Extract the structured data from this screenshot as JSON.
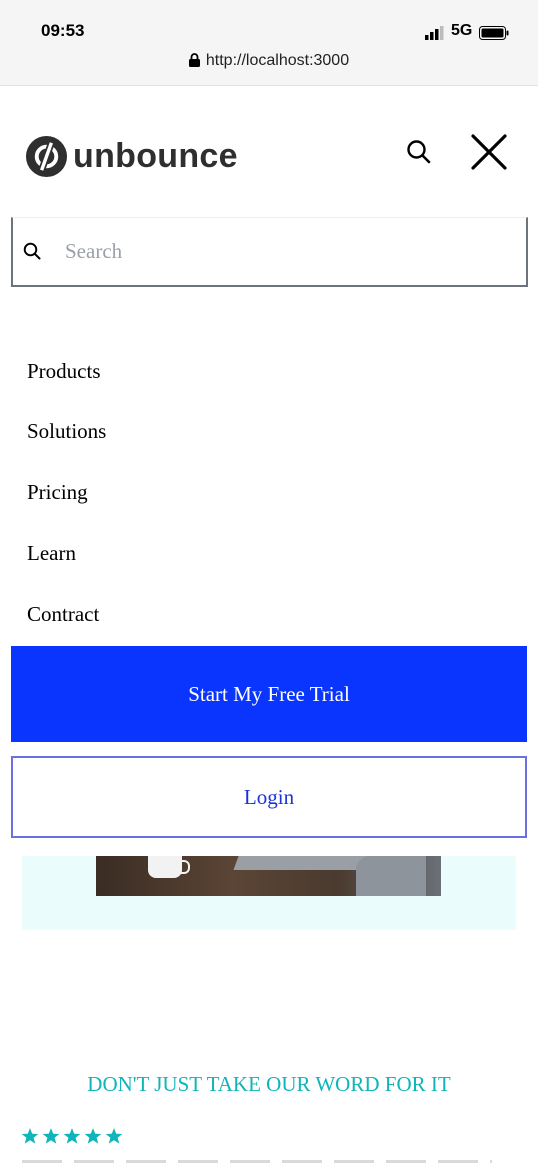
{
  "status_bar": {
    "time": "09:53",
    "network": "5G",
    "url": "http://localhost:3000"
  },
  "header": {
    "logo_text": "unbounce"
  },
  "search": {
    "placeholder": "Search",
    "value": ""
  },
  "menu": {
    "items": [
      {
        "label": "Products"
      },
      {
        "label": "Solutions"
      },
      {
        "label": "Pricing"
      },
      {
        "label": "Learn"
      },
      {
        "label": "Contract"
      }
    ]
  },
  "cta": {
    "trial_label": "Start My Free Trial",
    "login_label": "Login"
  },
  "testimonials": {
    "heading": "DON'T JUST TAKE OUR WORD FOR IT",
    "rating": 5
  },
  "colors": {
    "primary": "#0a35ff",
    "accent": "#0fb5b8",
    "login_border": "#6b6fe0"
  }
}
